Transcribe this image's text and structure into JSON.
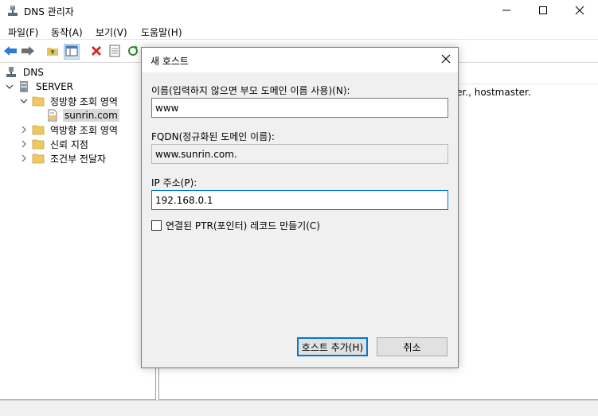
{
  "window": {
    "title": "DNS 관리자",
    "controls": [
      "minimize-icon",
      "maximize-icon",
      "close-icon"
    ]
  },
  "menubar": {
    "items": [
      "파일(F)",
      "동작(A)",
      "보기(V)",
      "도움말(H)"
    ]
  },
  "toolbar": {
    "buttons": [
      "back-arrow-icon",
      "forward-arrow-icon",
      "folder-up-icon",
      "show-hide-tree-icon",
      "delete-icon",
      "properties-icon",
      "refresh-icon",
      "export-icon",
      "help-icon",
      "server-icon",
      "list-icon",
      "host-icon"
    ]
  },
  "tree": {
    "root": "DNS",
    "server": "SERVER",
    "forward_zone": "정방향 조회 영역",
    "zone_item": "sunrin.com",
    "reverse_zone": "역방향 조회 영역",
    "trust_points": "신뢰 지점",
    "conditional_forwarders": "조건부 전달자"
  },
  "right_pane": {
    "partial_text": "ver., hostmaster."
  },
  "dialog": {
    "title": "새 호스트",
    "name_label": "이름(입력하지 않으면 부모 도메인 이름 사용)(N):",
    "name_value": "www",
    "fqdn_label": "FQDN(정규화된 도메인 이름):",
    "fqdn_value": "www.sunrin.com.",
    "ip_label": "IP 주소(P):",
    "ip_value": "192.168.0.1",
    "ptr_checkbox_label": "연결된 PTR(포인터) 레코드 만들기(C)",
    "ptr_checked": false,
    "add_host_button": "호스트 추가(H)",
    "cancel_button": "취소"
  }
}
